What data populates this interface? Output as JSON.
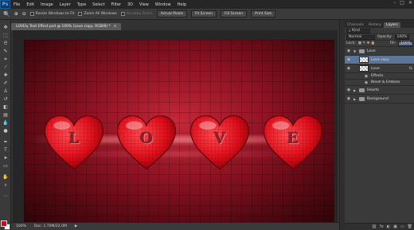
{
  "app": {
    "logo": "Ps"
  },
  "menu": [
    "File",
    "Edit",
    "Image",
    "Layer",
    "Type",
    "Select",
    "Filter",
    "3D",
    "View",
    "Window",
    "Help"
  ],
  "window_controls": [
    "–",
    "□",
    "✕"
  ],
  "options": {
    "resize_label": "Resize Windows to Fit",
    "zoom_all_label": "Zoom All Windows",
    "scrubby_label": "Scrubby Zoom",
    "actual_pixels": "Actual Pixels",
    "fit_screen": "Fit Screen",
    "fill_screen": "Fill Screen",
    "print_size": "Print Size"
  },
  "document": {
    "tab_title": "LOVEly Text Effect.psd @ 100% (Love copy, RGB/8) *",
    "close": "×",
    "letters": [
      "L",
      "O",
      "V",
      "E"
    ],
    "zoom": "100%",
    "doc_size": "Doc: 1.70M/22.0M"
  },
  "panels": {
    "tabs": [
      "Channels",
      "History",
      "Layers"
    ],
    "kind": "Kind",
    "blend_mode": "Normal",
    "opacity_label": "Opacity:",
    "opacity": "100%",
    "lock_label": "Lock:",
    "fill_label": "Fill:",
    "fill": "100%",
    "layers": [
      {
        "name": "Love",
        "type": "group",
        "open": true
      },
      {
        "name": "Love copy",
        "type": "layer",
        "selected": true
      },
      {
        "name": "Love",
        "type": "layer",
        "fx": "fx"
      },
      {
        "name": "Effects",
        "type": "effect"
      },
      {
        "name": "Bevel & Emboss",
        "type": "effect"
      },
      {
        "name": "Hearts",
        "type": "group",
        "open": false
      },
      {
        "name": "Background",
        "type": "group",
        "open": false
      }
    ],
    "bottom_icons": [
      "⛓",
      "fx",
      "◐",
      "▣",
      "▭",
      "🗑"
    ]
  },
  "colors": {
    "foreground": "#c4101a",
    "background": "#ffffff",
    "accent": "#5d7596"
  }
}
